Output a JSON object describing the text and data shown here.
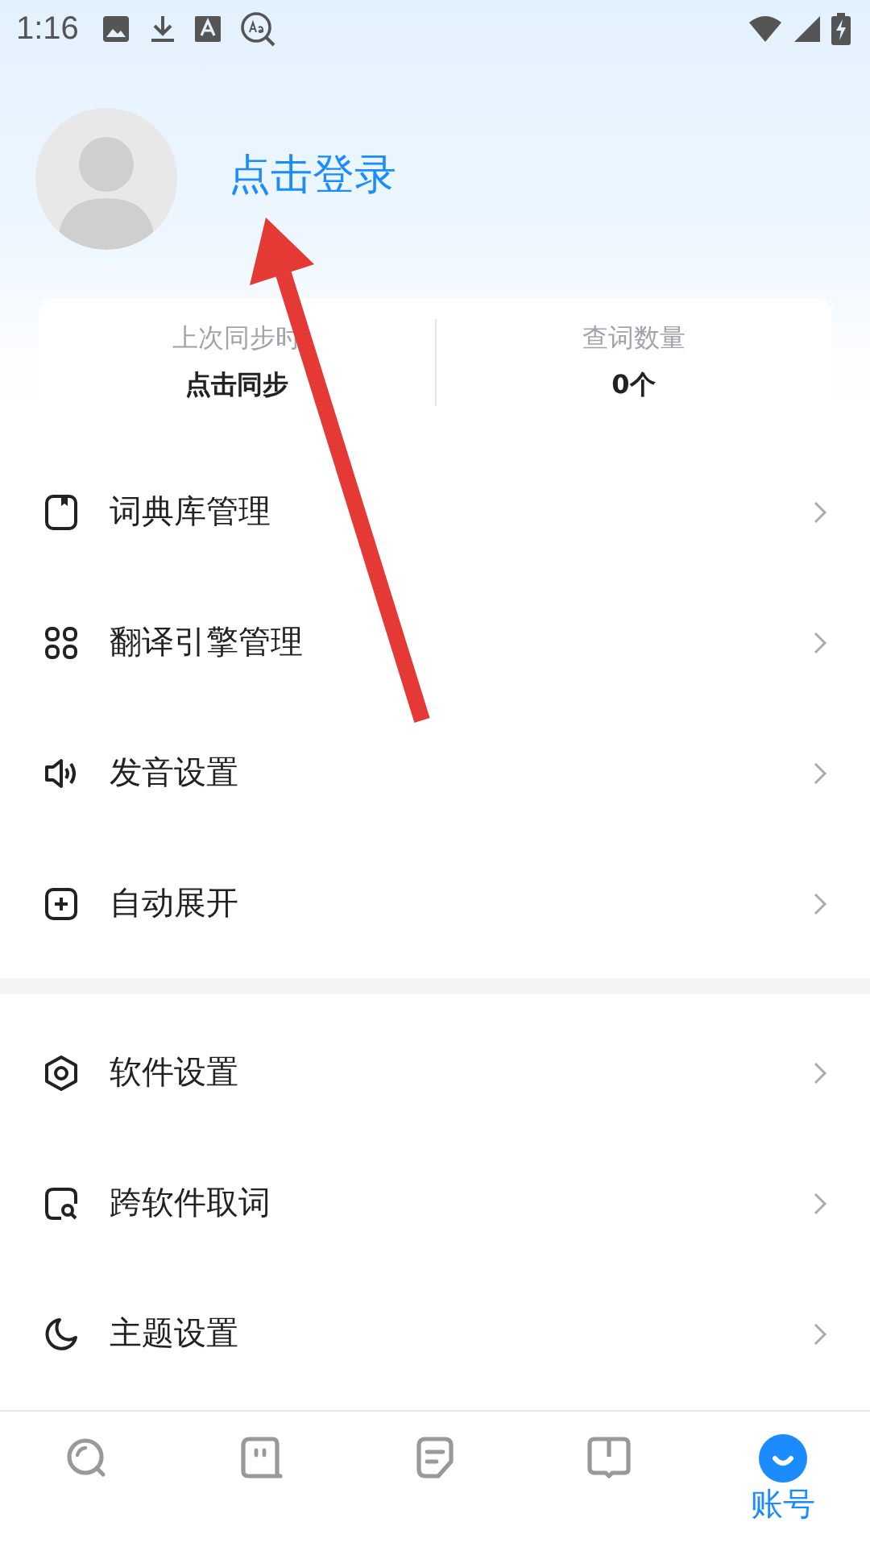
{
  "status_bar": {
    "time": "1:16"
  },
  "profile": {
    "login_link": "点击登录"
  },
  "stats": [
    {
      "label": "上次同步时",
      "value": "点击同步"
    },
    {
      "label": "查词数量",
      "value": "0个"
    }
  ],
  "menu_groups": [
    {
      "items": [
        {
          "label": "词典库管理"
        },
        {
          "label": "翻译引擎管理"
        },
        {
          "label": "发音设置"
        },
        {
          "label": "自动展开"
        }
      ]
    },
    {
      "items": [
        {
          "label": "软件设置"
        },
        {
          "label": "跨软件取词"
        },
        {
          "label": "主题设置"
        }
      ]
    }
  ],
  "bottom_nav": [
    {
      "selected": false
    },
    {
      "selected": false
    },
    {
      "selected": false
    },
    {
      "selected": false
    },
    {
      "label": "账号",
      "selected": true
    }
  ],
  "annotation": {
    "kind": "arrow"
  }
}
